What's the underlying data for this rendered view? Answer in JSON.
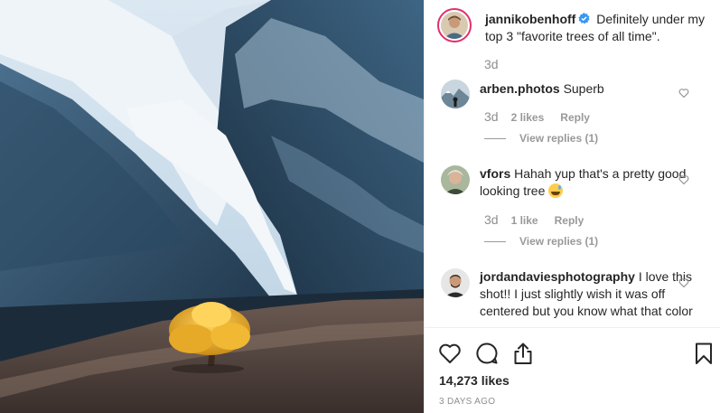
{
  "post": {
    "author": "jannikobenhoff",
    "caption": "Definitely under my top 3 \"favorite trees of all time\".",
    "caption_time": "3d",
    "likes": "14,273 likes",
    "date": "3 DAYS AGO"
  },
  "comments": [
    {
      "username": "arben.photos",
      "text": "Superb",
      "time": "3d",
      "likes": "2 likes",
      "reply_label": "Reply",
      "view_replies": "View replies (1)"
    },
    {
      "username": "vfors",
      "text": "Hahah yup that's a pretty good looking tree",
      "time": "3d",
      "likes": "1 like",
      "reply_label": "Reply",
      "view_replies": "View replies (1)"
    },
    {
      "username": "jordandaviesphotography",
      "text": "I love this shot!! I just slightly wish it was off centered but you know what that color"
    }
  ],
  "icons": {
    "like": "heart-icon",
    "comment": "comment-icon",
    "share": "share-icon",
    "save": "bookmark-icon",
    "verified": "verified-badge-icon",
    "comment_like": "heart-icon",
    "emoji": "sweat-smile-emoji"
  },
  "colors": {
    "text": "#262626",
    "secondary": "#8e8e8e",
    "verified": "#3897f0",
    "story_ring": "#e1306c"
  }
}
